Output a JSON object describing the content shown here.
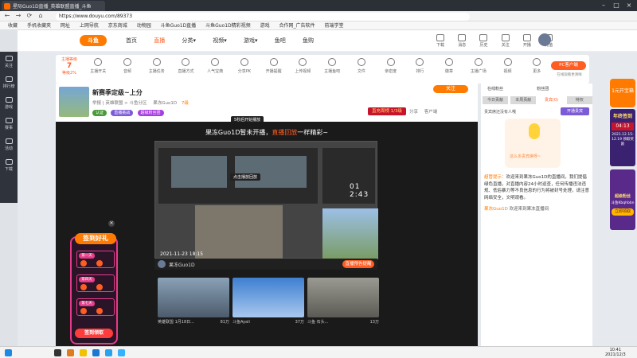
{
  "browser": {
    "tab_title": "星际Guo1D直播_英雄联盟直播_斗鱼",
    "url": "https://www.douyu.com/89373",
    "nav": [
      "←",
      "→",
      "⟳",
      "⌂"
    ],
    "bookmarks": [
      "收藏",
      "手机收藏夹",
      "网址",
      "上网导航",
      "京东商城",
      "动物园",
      "斗鱼Guo1D直播",
      "斗鱼Guo1D精彩视频",
      "游戏",
      "合作网_广告软件",
      "前端学堂"
    ]
  },
  "left_dock": [
    "关注",
    "排行榜",
    "游戏",
    "赛事",
    "活动",
    "下载"
  ],
  "site": {
    "logo": "斗鱼",
    "nav": [
      "首页",
      "直播",
      "分类▾",
      "视频▾",
      "游戏▾",
      "鱼吧",
      "鱼购"
    ],
    "header_right": [
      "下载",
      "消息",
      "历史",
      "关注",
      "开播",
      "充值"
    ]
  },
  "toolstrip": {
    "level_label": "主播等级",
    "level": "7",
    "level_sub": "等级2%",
    "tools": [
      "主播开关",
      "音频",
      "主播任务",
      "直播方式",
      "人气宝典",
      "分享PK",
      "开播提醒",
      "上传视频",
      "主播鱼吧",
      "文件",
      "亲密度",
      "排行",
      "徽章",
      "主播广场",
      "视频",
      "更多"
    ],
    "pc_button": "PC客户端",
    "pc_sub": "在线观看更清晰"
  },
  "room": {
    "title": "新赛季定级~上分",
    "tags": "举报 | 英雄联盟 > 斗鱼分区",
    "streamer": "果冻Guo1D",
    "level": "7级",
    "badges": [
      "认证",
      "直播挑战",
      "超级粉丝团"
    ],
    "follow": "关注",
    "rank": "直充周榜 1/3级",
    "actions": [
      "分享",
      "客户端"
    ],
    "tip": "5秒后开始播放"
  },
  "player": {
    "notlive_prefix": "果冻Guo1D暂未开播，",
    "notlive_hl": "直播回放",
    "notlive_suffix": "一样精彩~",
    "timestamp": "2021-11-23 18:15",
    "hint": "点击播放回放",
    "count": "01 2:43",
    "rec_name": "果冻Guo1D",
    "rec_button": "直播预告提醒",
    "thumbs": [
      {
        "title": "英雄联盟 1月18日...",
        "views": "81万"
      },
      {
        "title": "斗鱼Ayali",
        "views": "37万"
      },
      {
        "title": "斗鱼 石头...",
        "views": "13万"
      }
    ]
  },
  "gift": {
    "title": "签到好礼",
    "days": [
      "第一天",
      "第四天",
      "第七天"
    ],
    "button": "签到领取",
    "close": "×"
  },
  "chat": {
    "top_left": "在线粉丝",
    "top_right": "粉丝团",
    "tabs": [
      "今日贡献",
      "本周贡献",
      "贵宾(0)",
      "特权"
    ],
    "desc": "贵宾席还没有人哦",
    "button": "开通贵宾",
    "mascot_text": "这么多贵宾席呀~",
    "messages": [
      {
        "user": "超管提示：",
        "text": "欢迎来到果冻Guo1D的直播间，我们提倡绿色直播，对直播内容24小时巡查，任何传播违法违规、低俗暴力等不良信息的行为将被封号处理，请注意网络安全，文明观看。"
      },
      {
        "user": "果冻Guo1D",
        "text": "欢迎来到果冻直播间"
      }
    ]
  },
  "promo": {
    "top": "1元开宝箱",
    "mid_title": "年终签到",
    "countdown": "04:13",
    "mid_desc": "2021.12.15-12.19 领取奖励",
    "bottom_title": "超级粉丝",
    "bottom_sub": "斗鱼Kbqhbbn",
    "bottom_btn": "立即领取"
  },
  "taskbar": {
    "time": "10:41",
    "date": "2021/12/3"
  }
}
